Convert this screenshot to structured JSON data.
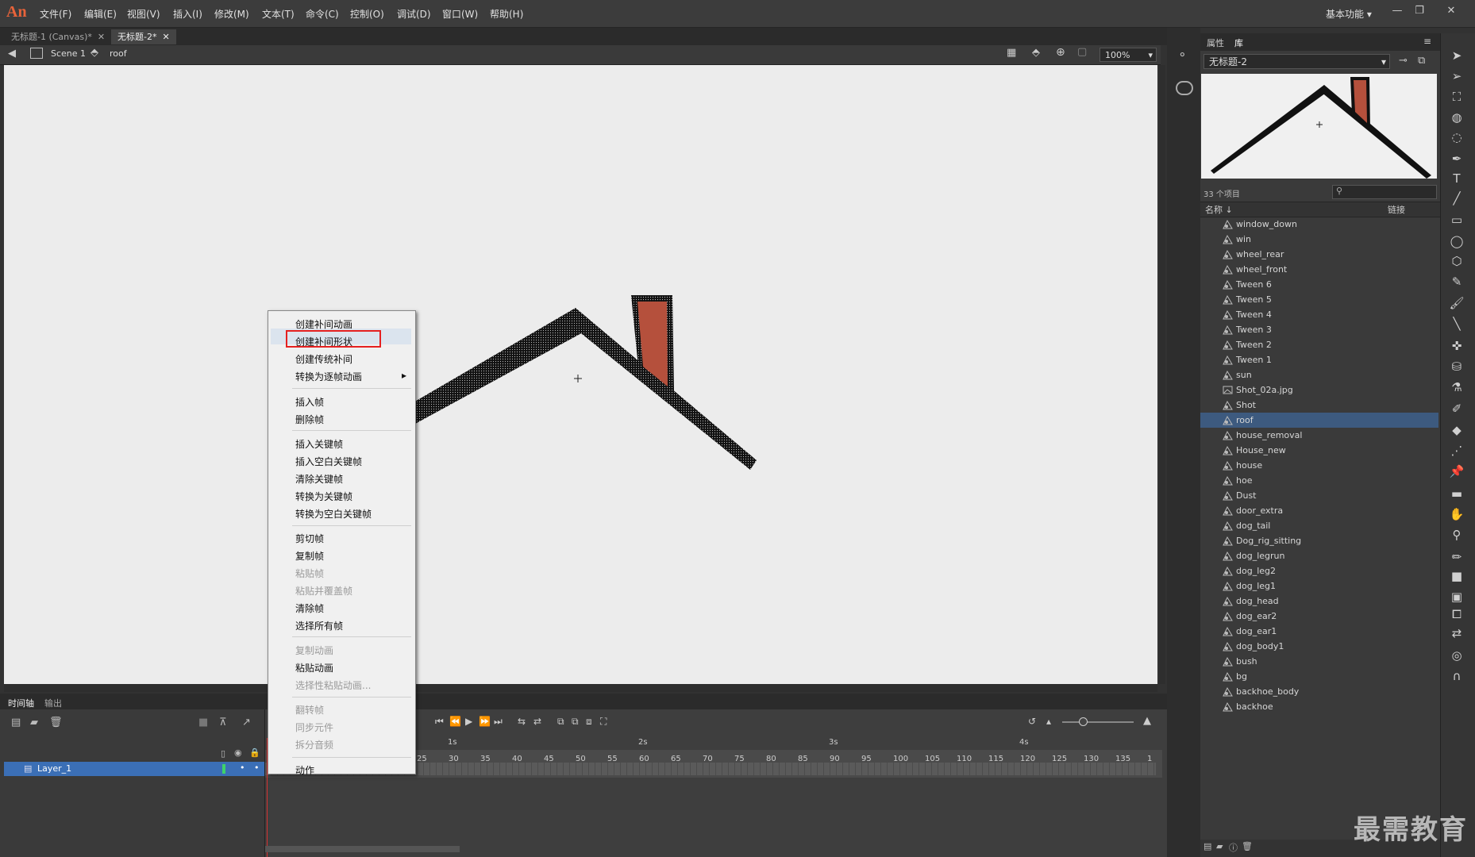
{
  "app": {
    "logo": "An"
  },
  "menubar": {
    "items": [
      "文件(F)",
      "编辑(E)",
      "视图(V)",
      "插入(I)",
      "修改(M)",
      "文本(T)",
      "命令(C)",
      "控制(O)",
      "调试(D)",
      "窗口(W)",
      "帮助(H)"
    ],
    "workspace": "基本功能"
  },
  "doc_tabs": [
    {
      "label": "无标题-1 (Canvas)*",
      "active": false
    },
    {
      "label": "无标题-2*",
      "active": true
    }
  ],
  "editbar": {
    "scene": "Scene 1",
    "symbol": "roof",
    "zoom": "100%"
  },
  "context_menu": {
    "items": [
      {
        "label": "创建补间动画",
        "enabled": true
      },
      {
        "label": "创建补间形状",
        "enabled": true,
        "highlighted": true
      },
      {
        "label": "创建传统补间",
        "enabled": true
      },
      {
        "label": "转换为逐帧动画",
        "enabled": true,
        "submenu": true
      },
      {
        "label": "插入帧",
        "enabled": true
      },
      {
        "label": "删除帧",
        "enabled": true
      },
      {
        "label": "插入关键帧",
        "enabled": true
      },
      {
        "label": "插入空白关键帧",
        "enabled": true
      },
      {
        "label": "清除关键帧",
        "enabled": true
      },
      {
        "label": "转换为关键帧",
        "enabled": true
      },
      {
        "label": "转换为空白关键帧",
        "enabled": true
      },
      {
        "label": "剪切帧",
        "enabled": true
      },
      {
        "label": "复制帧",
        "enabled": true
      },
      {
        "label": "粘贴帧",
        "enabled": false
      },
      {
        "label": "粘贴并覆盖帧",
        "enabled": false
      },
      {
        "label": "清除帧",
        "enabled": true
      },
      {
        "label": "选择所有帧",
        "enabled": true
      },
      {
        "label": "复制动画",
        "enabled": false
      },
      {
        "label": "粘贴动画",
        "enabled": true
      },
      {
        "label": "选择性粘贴动画...",
        "enabled": false
      },
      {
        "label": "翻转帧",
        "enabled": false
      },
      {
        "label": "同步元件",
        "enabled": false
      },
      {
        "label": "拆分音频",
        "enabled": false
      },
      {
        "label": "动作",
        "enabled": true
      }
    ],
    "submenu_arrow": "▸"
  },
  "timeline": {
    "tabs": [
      "时间轴",
      "输出"
    ],
    "layer": "Layer_1",
    "seconds": [
      "1s",
      "2s",
      "3s",
      "4s"
    ],
    "frame_ticks": [
      "25",
      "30",
      "35",
      "40",
      "45",
      "50",
      "55",
      "60",
      "65",
      "70",
      "75",
      "80",
      "85",
      "90",
      "95",
      "100",
      "105",
      "110",
      "115",
      "120",
      "125",
      "130",
      "135",
      "1"
    ]
  },
  "library": {
    "tabs": [
      "属性",
      "库"
    ],
    "document": "无标题-2",
    "item_count": "33 个项目",
    "col_name": "名称",
    "col_link": "链接",
    "items": [
      {
        "name": "window_down"
      },
      {
        "name": "win"
      },
      {
        "name": "wheel_rear"
      },
      {
        "name": "wheel_front"
      },
      {
        "name": "Tween 6"
      },
      {
        "name": "Tween 5"
      },
      {
        "name": "Tween 4"
      },
      {
        "name": "Tween 3"
      },
      {
        "name": "Tween 2"
      },
      {
        "name": "Tween 1"
      },
      {
        "name": "sun"
      },
      {
        "name": "Shot_02a.jpg",
        "type": "bitmap"
      },
      {
        "name": "Shot"
      },
      {
        "name": "roof",
        "selected": true
      },
      {
        "name": "house_removal"
      },
      {
        "name": "House_new"
      },
      {
        "name": "house"
      },
      {
        "name": "hoe"
      },
      {
        "name": "Dust"
      },
      {
        "name": "door_extra"
      },
      {
        "name": "dog_tail"
      },
      {
        "name": "Dog_rig_sitting"
      },
      {
        "name": "dog_legrun"
      },
      {
        "name": "dog_leg2"
      },
      {
        "name": "dog_leg1"
      },
      {
        "name": "dog_head"
      },
      {
        "name": "dog_ear2"
      },
      {
        "name": "dog_ear1"
      },
      {
        "name": "dog_body1"
      },
      {
        "name": "bush"
      },
      {
        "name": "bg"
      },
      {
        "name": "backhoe_body"
      },
      {
        "name": "backhoe"
      }
    ]
  },
  "watermark": "最需教育",
  "colors": {
    "accent": "#3b6fb6",
    "chimney": "#b5503c",
    "highlight_box": "#e52020"
  }
}
